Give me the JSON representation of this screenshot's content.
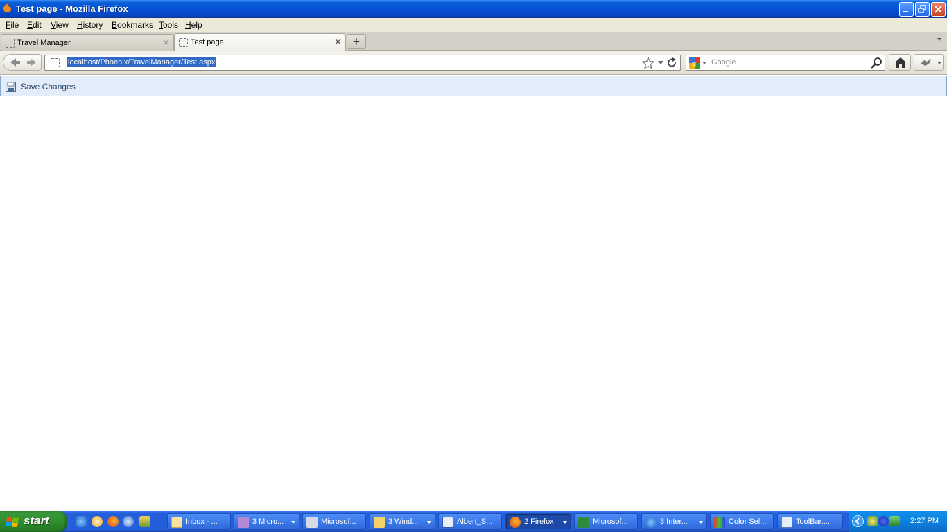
{
  "window": {
    "title": "Test page - Mozilla Firefox"
  },
  "menu": {
    "items": [
      "File",
      "Edit",
      "View",
      "History",
      "Bookmarks",
      "Tools",
      "Help"
    ]
  },
  "tabs": [
    {
      "label": "Travel Manager",
      "active": false
    },
    {
      "label": "Test page",
      "active": true
    }
  ],
  "nav": {
    "url": "localhost/Phoenix/TravelManager/Test.aspx",
    "search_placeholder": "Google"
  },
  "page": {
    "save_label": "Save Changes"
  },
  "taskbar": {
    "start_label": "start",
    "tasks": [
      {
        "label": "Inbox - ...",
        "icon": "outlook-icon",
        "group": false,
        "active": false
      },
      {
        "label": "3 Micro...",
        "icon": "visual-studio-icon",
        "group": true,
        "active": false
      },
      {
        "label": "Microsof...",
        "icon": "tools-icon",
        "group": false,
        "active": false
      },
      {
        "label": "3 Wind...",
        "icon": "folder-icon",
        "group": true,
        "active": false
      },
      {
        "label": "Albert_S...",
        "icon": "word-icon",
        "group": false,
        "active": false
      },
      {
        "label": "2 Firefox",
        "icon": "firefox-icon",
        "group": true,
        "active": true
      },
      {
        "label": "Microsof...",
        "icon": "excel-icon",
        "group": false,
        "active": false
      },
      {
        "label": "3 Inter...",
        "icon": "ie-icon",
        "group": true,
        "active": false
      },
      {
        "label": "Color Sel...",
        "icon": "color-icon",
        "group": false,
        "active": false
      },
      {
        "label": "ToolBar....",
        "icon": "document-icon",
        "group": false,
        "active": false
      }
    ],
    "clock": "2:27 PM"
  },
  "colors": {
    "titlebar": "#0553d6",
    "url_selection": "#316ac5",
    "page_toolbar": "#e3edf9",
    "taskbar": "#245edb",
    "start_button": "#2f8f2f"
  }
}
